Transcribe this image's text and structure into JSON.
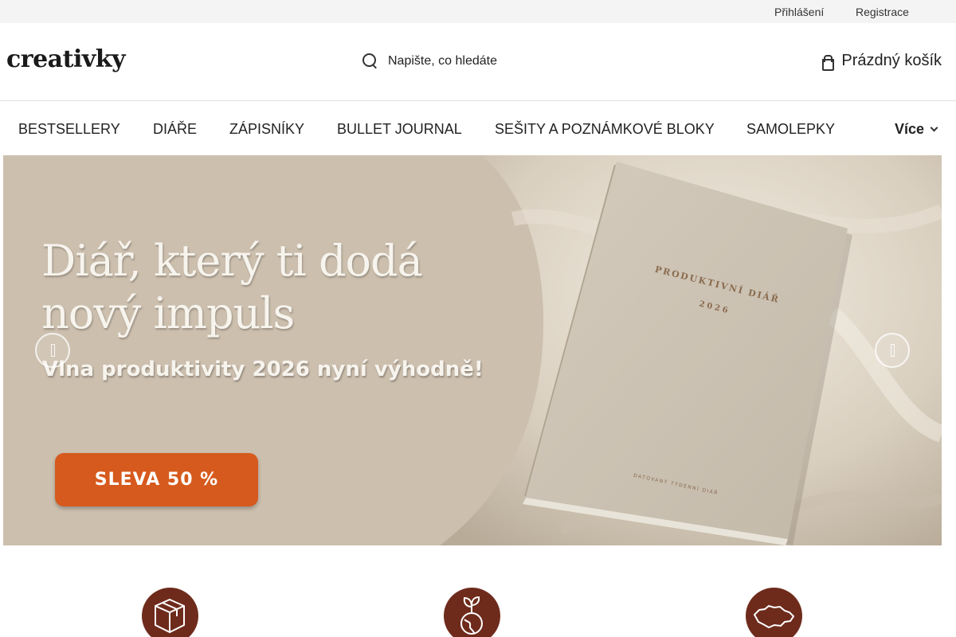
{
  "topbar": {
    "login_label": "Přihlášení",
    "register_label": "Registrace"
  },
  "header": {
    "logo_text": "creativky",
    "search": {
      "placeholder": "Napište, co hledáte",
      "icon": "search-icon"
    },
    "cart": {
      "label": "Prázdný košík",
      "icon": "cart-icon"
    }
  },
  "nav": {
    "items": [
      {
        "label": "BESTSELLERY"
      },
      {
        "label": "DIÁŘE"
      },
      {
        "label": "ZÁPISNÍKY"
      },
      {
        "label": "BULLET JOURNAL"
      },
      {
        "label": "SEŠITY A POZNÁMKOVÉ BLOKY"
      },
      {
        "label": "SAMOLEPKY"
      }
    ],
    "more_label": "Více",
    "more_icon": "chevron-down-icon"
  },
  "hero": {
    "headline": "Diář, který ti dodá nový impuls",
    "subheadline": "Vlna produktivity 2026 nyní výhodně!",
    "cta_label": "SLEVA 50 %",
    "book_title": "PRODUKTIVNÍ DIÁŘ",
    "book_year": "2026",
    "book_footer": "DATOVANÝ TÝDENNÍ DIÁŘ",
    "prev_icon": "arrow-left-icon",
    "next_icon": "arrow-right-icon",
    "colors": {
      "background": "#ccbfae",
      "cta": "#d65a1d",
      "text": "#f7f4ee"
    }
  },
  "benefits": {
    "icons": [
      "package-icon",
      "eco-planet-icon",
      "czech-map-icon"
    ],
    "color": "#6e2b1c"
  }
}
